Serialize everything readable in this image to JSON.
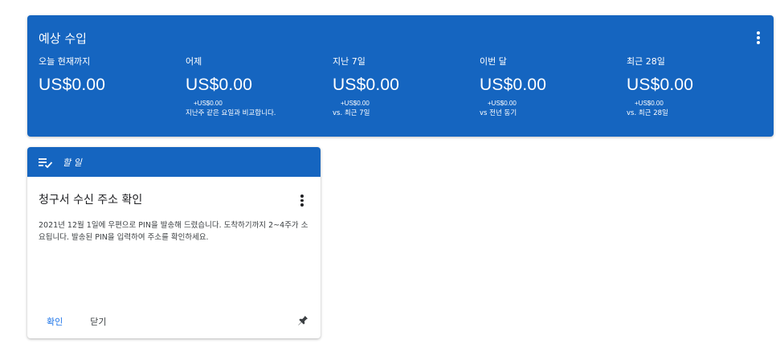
{
  "earnings": {
    "title": "예상 수입",
    "menu_icon": "more-vert-icon",
    "background_color": "#1565c0",
    "metrics": [
      {
        "label": "오늘 현재까지",
        "value": "US$0.00",
        "delta": "",
        "note": ""
      },
      {
        "label": "어제",
        "value": "US$0.00",
        "delta": "+US$0.00",
        "note": "지난주 같은 요일과 비교합니다."
      },
      {
        "label": "지난 7일",
        "value": "US$0.00",
        "delta": "+US$0.00",
        "note": "vs. 최근 7일"
      },
      {
        "label": "이번 달",
        "value": "US$0.00",
        "delta": "+US$0.00",
        "note": "vs 전년 동기"
      },
      {
        "label": "최근 28일",
        "value": "US$0.00",
        "delta": "+US$0.00",
        "note": "vs. 최근 28일"
      }
    ]
  },
  "todo": {
    "header_label": "할 일",
    "header_icon": "checklist-icon",
    "title": "청구서 수신 주소 확인",
    "menu_icon": "more-vert-icon",
    "text": "2021년 12월 1일에 우편으로 PIN을 발송해 드렸습니다. 도착하기까지 2~4주가 소요됩니다. 발송된 PIN을 입력하여 주소를 확인하세요.",
    "confirm_label": "확인",
    "close_label": "닫기",
    "pin_icon": "pin-icon",
    "accent_color": "#1a73e8"
  }
}
